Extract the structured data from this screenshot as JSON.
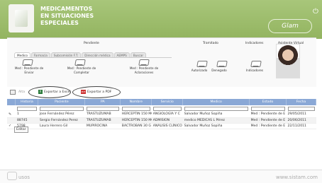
{
  "header": {
    "title_lines": [
      "MEDICAMENTOS",
      "EN SITUACIONES",
      "ESPECIALES"
    ],
    "brand": "Glam",
    "power_icon": "power-icon"
  },
  "summary": {
    "col_pendiente": "Pendiente",
    "col_tramitado": "Tramitado",
    "col_indicadores": "Indicadores",
    "col_asistente": "Asistente Virtual",
    "tabs": [
      "Medico",
      "Farmacia",
      "Subcomisión F.T.",
      "Dirección médica",
      "AEMPS",
      "Buscar"
    ],
    "trays": [
      {
        "label": "Med : Pendiente de Enviar"
      },
      {
        "label": "Med : Pendiente de Completar"
      },
      {
        "label": "Med : Pendiente de Aclaraciones"
      },
      {
        "label": "Autorizado"
      },
      {
        "label": "Denegado"
      },
      {
        "label": "Indicadores"
      }
    ]
  },
  "toolbar": {
    "alta_label": "Alta",
    "excel_label": "Exportar a Excel",
    "pdf_label": "Exportar a PDF"
  },
  "table": {
    "headers": [
      "",
      "Historia",
      "Paciente",
      "PA",
      "Nombre",
      "Servicio",
      "Medico",
      "Estado",
      "Fecha"
    ],
    "rows": [
      [
        "✎",
        "1",
        "Jose Fernández Pérez",
        "TRASTUZUMAB",
        "HERCEPTIN 150 MG",
        "ANGIOLOGÍA Y C",
        "Salvador Muñoz Sopiña",
        "Med : Pendiente de E",
        "29/05/2011"
      ],
      [
        "",
        "88745",
        "Sergio Fernández Perez",
        "TRASTUZUMAB",
        "HERCEPTIN 150 MG",
        "ADMISION",
        "medico MEDICAS L Pérez",
        "Med : Pendiente de E",
        "20/06/2011"
      ],
      [
        "✓",
        "5798",
        "Laura Herrero Gil",
        "MUPIROCINA",
        "BACTROBAN 30 G FI",
        "ANÁLISIS CLÍNICO",
        "Salvador Muñoz Sopiña",
        "Med : Pendiente de E",
        "22/11/2011"
      ]
    ],
    "editar": "Editar"
  },
  "footer": {
    "left": "usos",
    "right": "www.sistam.com"
  }
}
